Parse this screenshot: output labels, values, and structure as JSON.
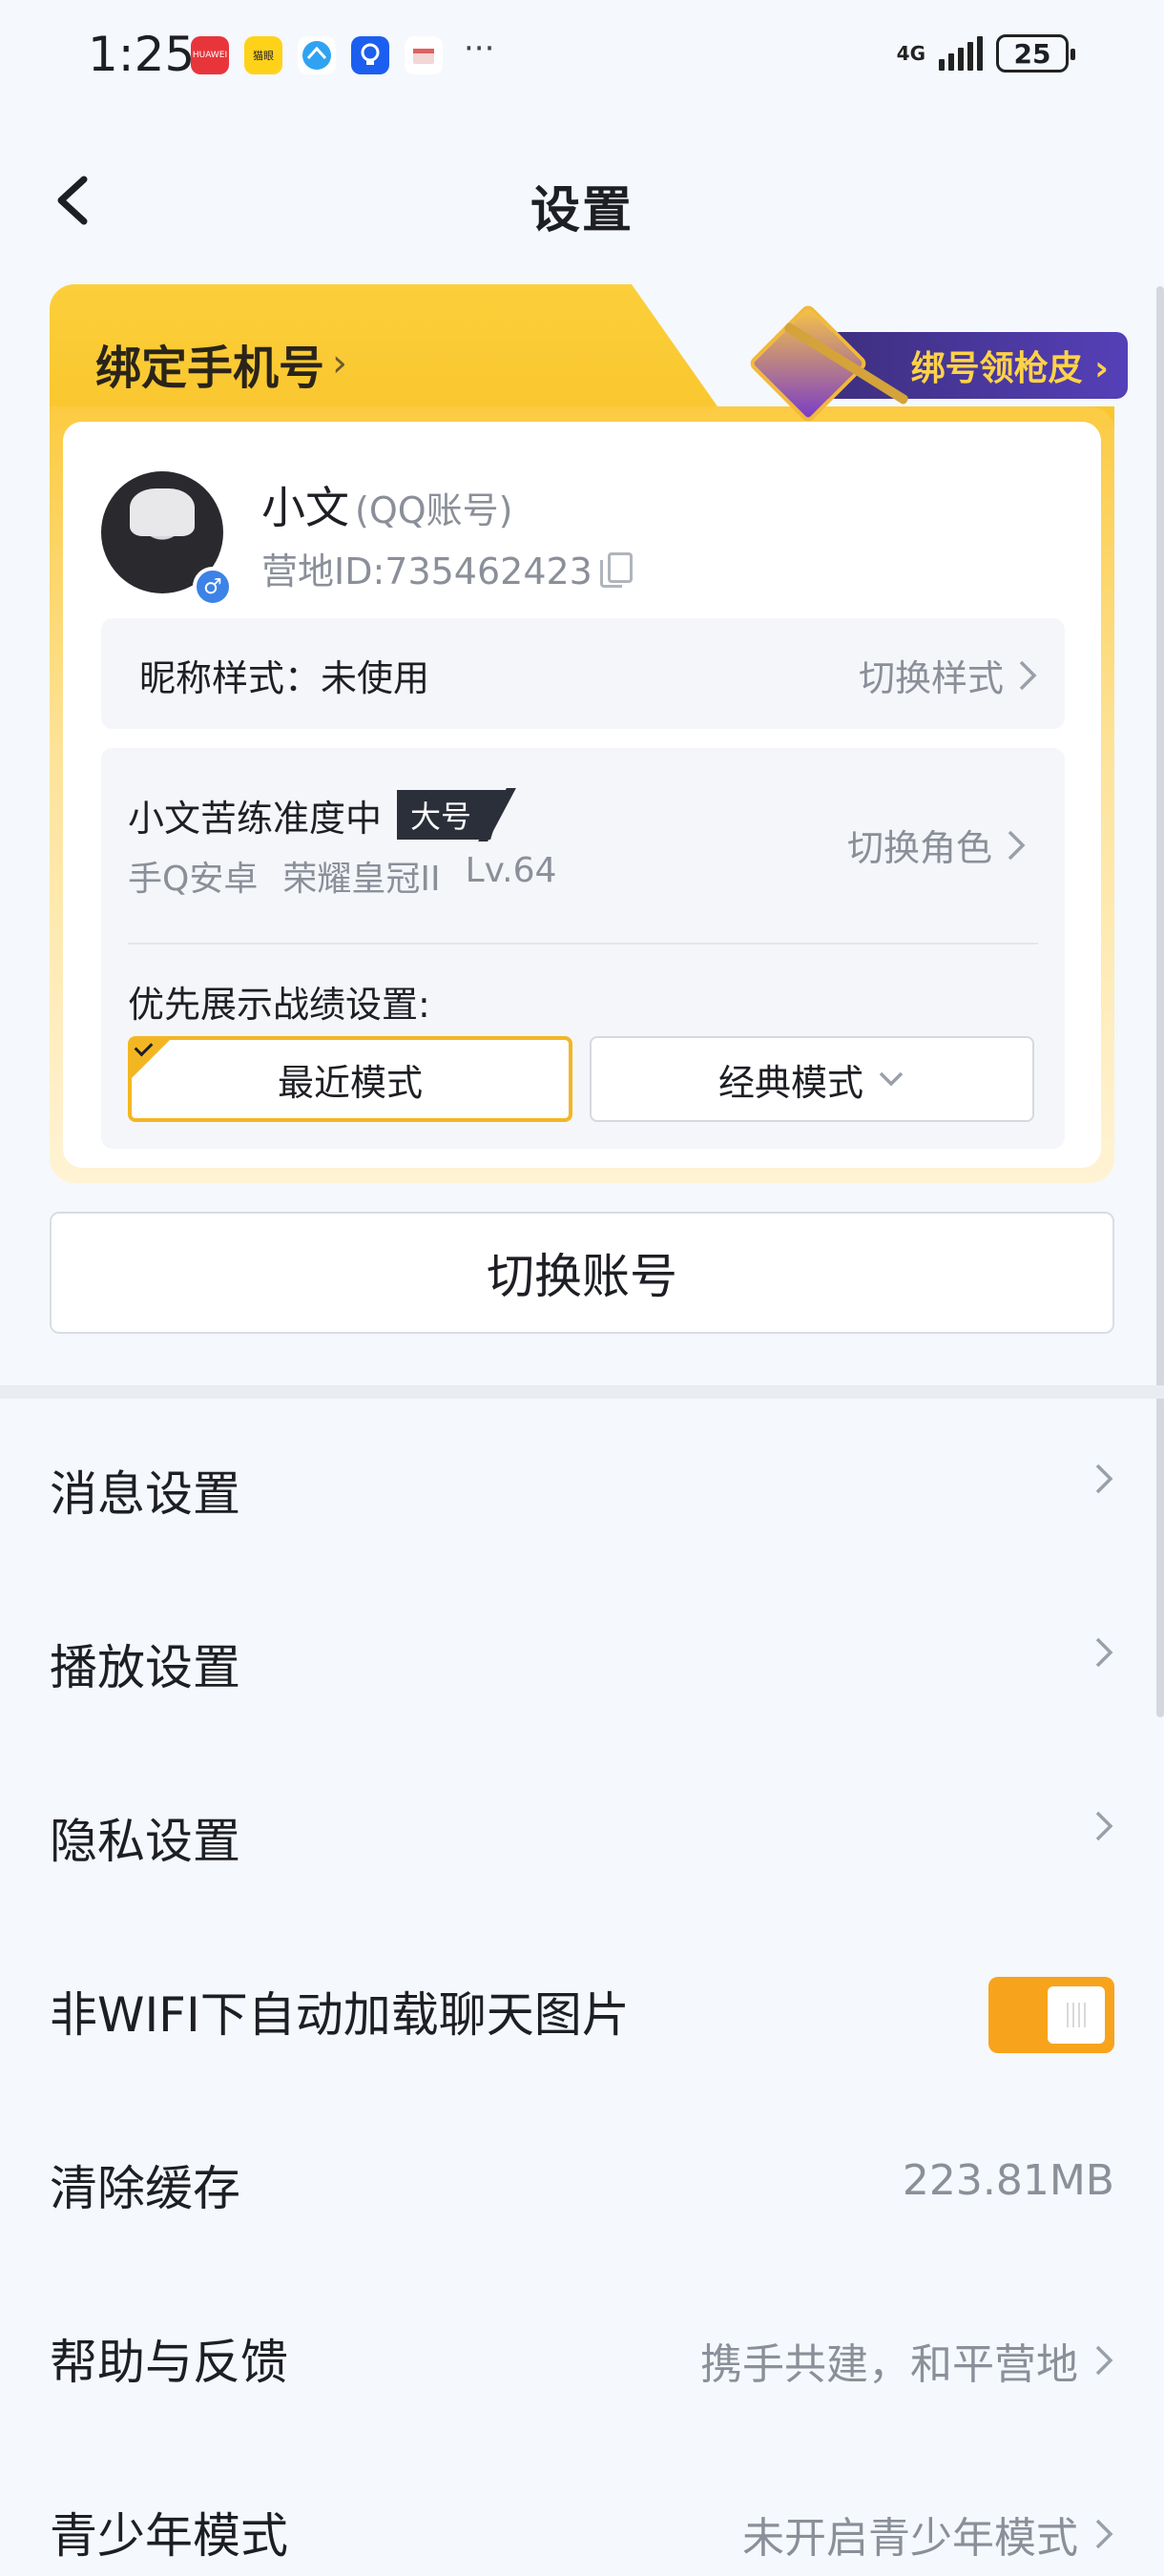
{
  "status_bar": {
    "time": "1:25",
    "apps": [
      "HUAWEI",
      "猫眼",
      "",
      "",
      ""
    ],
    "more": "···",
    "network": "4G",
    "battery": "25"
  },
  "header": {
    "title": "设置"
  },
  "profile_card": {
    "bind_phone": "绑定手机号",
    "bind_phone_chevron": "›",
    "skin_promo": "绑号领枪皮 ›",
    "user_name": "小文",
    "account_type": "(QQ账号)",
    "camp_id": "营地ID:735462423",
    "gender_symbol": "♂",
    "nickname_style_label": "昵称样式：未使用",
    "nickname_switch": "切换样式",
    "role_name": "小文苦练准度中",
    "role_tag": "大号",
    "role_platform": "手Q安卓",
    "role_rank": "荣耀皇冠II",
    "role_level": "Lv.64",
    "role_switch": "切换角色",
    "pref_label": "优先展示战绩设置:",
    "mode_recent": "最近模式",
    "mode_classic": "经典模式"
  },
  "switch_account": "切换账号",
  "settings": [
    {
      "label": "消息设置",
      "value": "",
      "type": "nav"
    },
    {
      "label": "播放设置",
      "value": "",
      "type": "nav"
    },
    {
      "label": "隐私设置",
      "value": "",
      "type": "nav"
    },
    {
      "label": "非WIFI下自动加载聊天图片",
      "value": "",
      "type": "toggle",
      "on": true
    },
    {
      "label": "清除缓存",
      "value": "223.81MB",
      "type": "value"
    },
    {
      "label": "帮助与反馈",
      "value": "携手共建，和平营地",
      "type": "nav"
    },
    {
      "label": "青少年模式",
      "value": "未开启青少年模式",
      "type": "nav"
    }
  ],
  "colors": {
    "accent": "#f8a31c",
    "card_yellow": "#fbcf3a",
    "text_primary": "#1d1f24",
    "text_secondary": "#8a8f99"
  }
}
